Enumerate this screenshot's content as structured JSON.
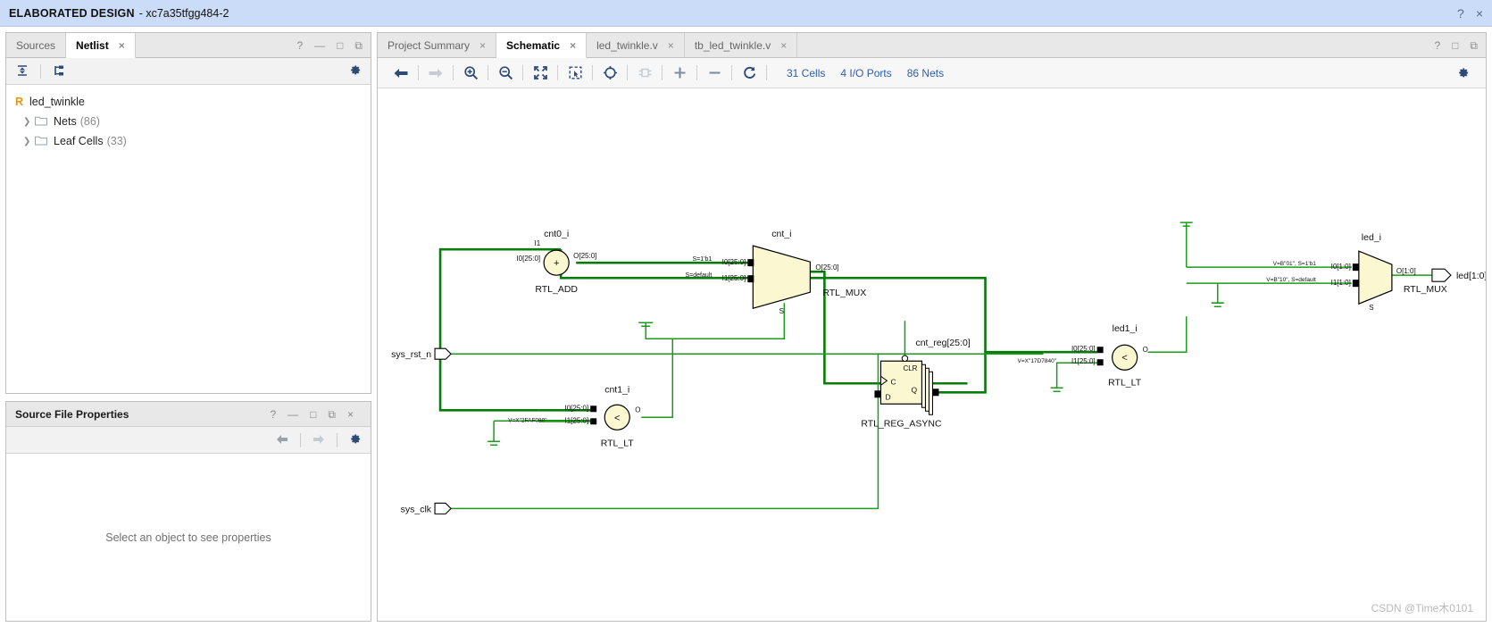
{
  "titlebar": {
    "main": "ELABORATED DESIGN",
    "sub": "- xc7a35tfgg484-2",
    "help_icon": "?",
    "close_icon": "×"
  },
  "left_panel": {
    "tabs": [
      {
        "label": "Sources",
        "active": false,
        "closable": false
      },
      {
        "label": "Netlist",
        "active": true,
        "closable": true,
        "close_icon": "×"
      }
    ],
    "controls": {
      "help": "?",
      "minimize": "—",
      "maximize": "□",
      "float": "⧉"
    },
    "toolbar": {
      "collapse_all_icon": "collapse-all-icon",
      "expand_hier_icon": "expand-hierarchy-icon",
      "settings_icon": "gear-icon"
    },
    "tree": {
      "root": {
        "badge": "R",
        "label": "led_twinkle"
      },
      "children": [
        {
          "label": "Nets",
          "count": "(86)"
        },
        {
          "label": "Leaf Cells",
          "count": "(33)"
        }
      ]
    }
  },
  "properties_panel": {
    "title": "Source File Properties",
    "controls": {
      "help": "?",
      "minimize": "—",
      "maximize": "□",
      "float": "⧉",
      "close": "×"
    },
    "nav": {
      "back_icon": "back-arrow-icon",
      "forward_icon": "forward-arrow-icon",
      "settings_icon": "gear-icon"
    },
    "empty_message": "Select an object to see properties"
  },
  "editor": {
    "tabs": [
      {
        "label": "Project Summary",
        "active": false,
        "close_icon": "×"
      },
      {
        "label": "Schematic",
        "active": true,
        "close_icon": "×"
      },
      {
        "label": "led_twinkle.v",
        "active": false,
        "close_icon": "×"
      },
      {
        "label": "tb_led_twinkle.v",
        "active": false,
        "close_icon": "×"
      }
    ],
    "controls": {
      "help": "?",
      "maximize": "□",
      "float": "⧉"
    },
    "toolbar": {
      "buttons": [
        {
          "name": "back-icon",
          "enabled": true
        },
        {
          "name": "forward-icon",
          "enabled": false
        },
        {
          "name": "zoom-in-icon",
          "enabled": true
        },
        {
          "name": "zoom-out-icon",
          "enabled": true
        },
        {
          "name": "zoom-fit-icon",
          "enabled": true
        },
        {
          "name": "zoom-area-icon",
          "enabled": true
        },
        {
          "name": "zoom-selection-icon",
          "enabled": true
        },
        {
          "name": "expand-cell-icon",
          "enabled": false
        },
        {
          "name": "add-icon",
          "enabled": true
        },
        {
          "name": "remove-icon",
          "enabled": true
        },
        {
          "name": "regenerate-icon",
          "enabled": true
        }
      ],
      "stats": [
        {
          "label": "31 Cells"
        },
        {
          "label": "4 I/O Ports"
        },
        {
          "label": "86 Nets"
        }
      ],
      "settings_icon": "gear-icon"
    }
  },
  "schematic": {
    "watermark": "CSDN @Time木0101",
    "ports": [
      {
        "name": "sys_rst_n",
        "kind": "input"
      },
      {
        "name": "sys_clk",
        "kind": "input"
      },
      {
        "name": "led[1:0]",
        "kind": "output"
      }
    ],
    "cells": [
      {
        "instance": "cnt0_i",
        "type": "RTL_ADD",
        "shape": "circle",
        "symbol": "+",
        "inputs": [
          "I1",
          "I0[25:0]"
        ],
        "outputs": [
          "O[25:0]"
        ]
      },
      {
        "instance": "cnt_i",
        "type": "RTL_MUX",
        "shape": "mux",
        "inputs": [
          "I0[25:0]",
          "I1[25:0]"
        ],
        "select": "S",
        "outputs": [
          "O[25:0]"
        ],
        "input_conditions": [
          "S=1'b1",
          "S=default"
        ]
      },
      {
        "instance": "cnt1_i",
        "type": "RTL_LT",
        "shape": "circle",
        "symbol": "<",
        "inputs": [
          "I0[25:0]",
          "I1[25:0]"
        ],
        "outputs": [
          "O"
        ],
        "constant": "V=X\"2FAF080\""
      },
      {
        "instance": "cnt_reg[25:0]",
        "type": "RTL_REG_ASYNC",
        "shape": "register",
        "pins": [
          "CLR",
          "C",
          "D",
          "Q"
        ]
      },
      {
        "instance": "led1_i",
        "type": "RTL_LT",
        "shape": "circle",
        "symbol": "<",
        "inputs": [
          "I0[25:0]",
          "I1[25:0]"
        ],
        "outputs": [
          "O"
        ],
        "constant": "V=X\"17D7840\""
      },
      {
        "instance": "led_i",
        "type": "RTL_MUX",
        "shape": "mux",
        "inputs": [
          "I0[1:0]",
          "I1[1:0]"
        ],
        "select": "S",
        "outputs": [
          "O[1:0]"
        ],
        "input_conditions": [
          "V=B\"01\", S=1'b1",
          "V=B\"10\", S=default"
        ]
      }
    ],
    "colors": {
      "wire_thin": "#1a9c1a",
      "wire_bus": "#0a7a0a",
      "cell_fill": "#fbf7d1",
      "cell_stroke": "#000000",
      "port_stroke": "#000000"
    }
  }
}
